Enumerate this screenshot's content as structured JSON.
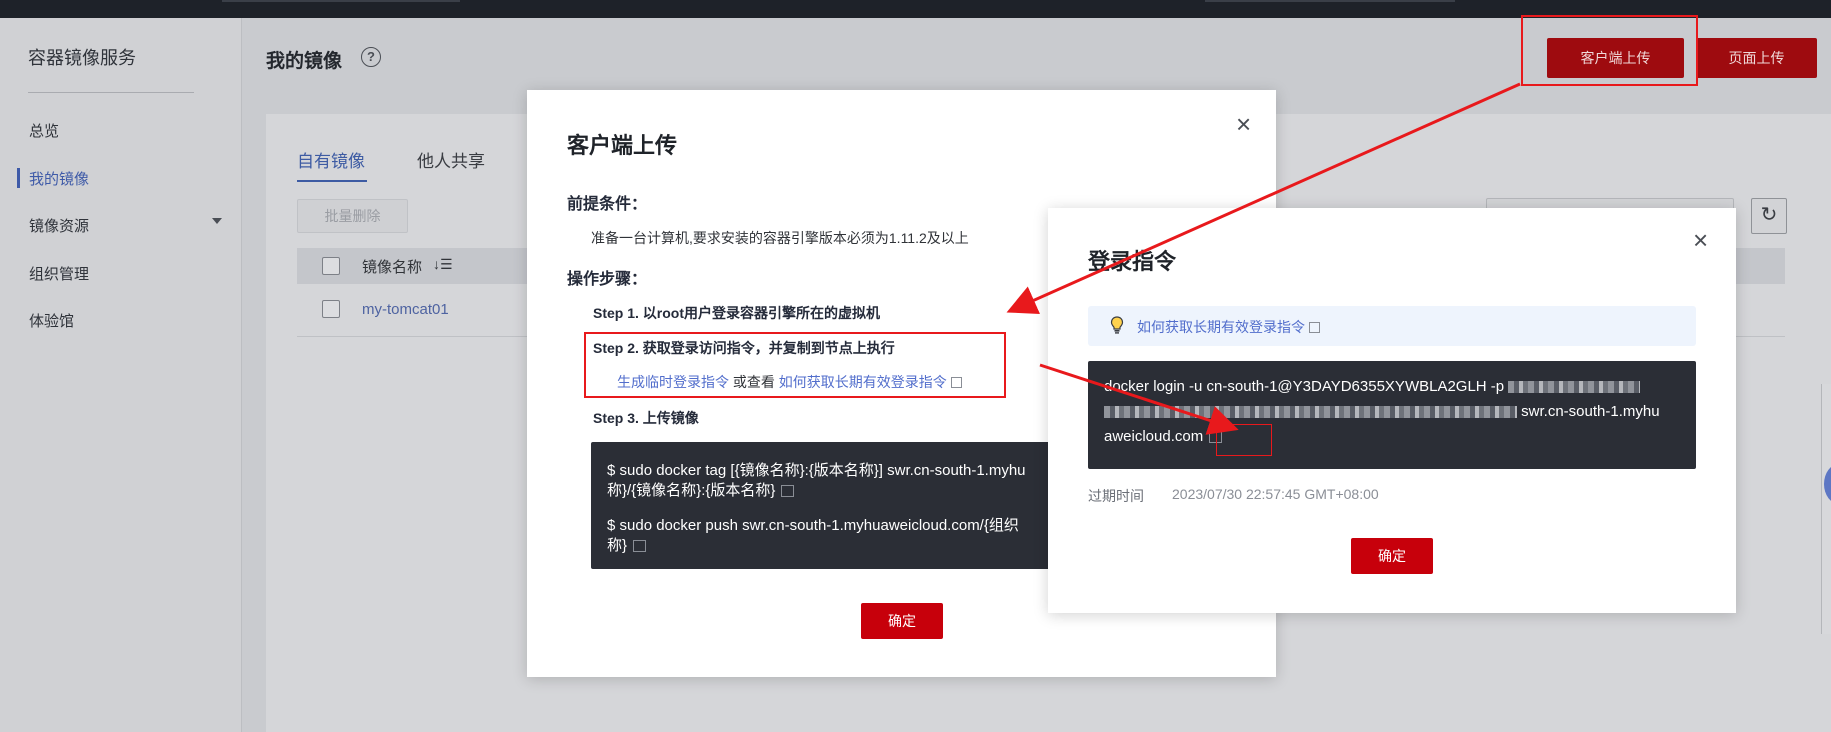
{
  "sidebar": {
    "title": "容器镜像服务",
    "items": [
      {
        "label": "总览"
      },
      {
        "label": "我的镜像"
      },
      {
        "label": "镜像资源"
      },
      {
        "label": "组织管理"
      },
      {
        "label": "体验馆"
      }
    ]
  },
  "header": {
    "page_title": "我的镜像",
    "help_glyph": "?",
    "client_upload_label": "客户端上传",
    "page_upload_label": "页面上传"
  },
  "main": {
    "tabs": [
      {
        "label": "自有镜像"
      },
      {
        "label": "他人共享"
      }
    ],
    "bulk_delete_label": "批量删除",
    "table": {
      "column_name": "镜像名称",
      "sort_glyph": "↓☰",
      "rows": [
        {
          "name": "my-tomcat01"
        }
      ]
    },
    "refresh_glyph": "↻"
  },
  "dialog_client_upload": {
    "title": "客户端上传",
    "close_glyph": "×",
    "prereq_title": "前提条件：",
    "prereq_text": "准备一台计算机,要求安装的容器引擎版本必须为1.11.2及以上",
    "steps_title": "操作步骤：",
    "step1": "Step 1. 以root用户登录容器引擎所在的虚拟机",
    "step2": "Step 2. 获取登录访问指令，并复制到节点上执行",
    "step2_link_temp": "生成临时登录指令",
    "step2_or": " 或查看 ",
    "step2_link_long": "如何获取长期有效登录指令",
    "step3": "Step 3. 上传镜像",
    "code_tag_line1": "$ sudo docker tag [{镜像名称}:{版本名称}] swr.cn-south-1.myhu",
    "code_tag_line2": "称}/{镜像名称}:{版本名称}",
    "code_push_line1": "$ sudo docker push swr.cn-south-1.myhuaweicloud.com/{组织",
    "code_push_line2": "称}",
    "ok_label": "确定"
  },
  "dialog_login": {
    "title": "登录指令",
    "close_glyph": "×",
    "tip_link": "如何获取长期有效登录指令",
    "cmd_line1": "docker login -u cn-south-1@Y3DAYD6355XYWBLA2GLH -p",
    "cmd_line2_tail": "swr.cn-south-1.myhu",
    "cmd_line3": "aweicloud.com",
    "expire_label": "过期时间",
    "expire_value": "2023/07/30 22:57:45 GMT+08:00",
    "ok_label": "确定"
  },
  "colors": {
    "brand_red": "#c7000b",
    "header_button_red": "#9e0b0f",
    "annotation_red": "#e8191c",
    "link_blue": "#526ecc",
    "code_bg": "#2b2e36"
  }
}
